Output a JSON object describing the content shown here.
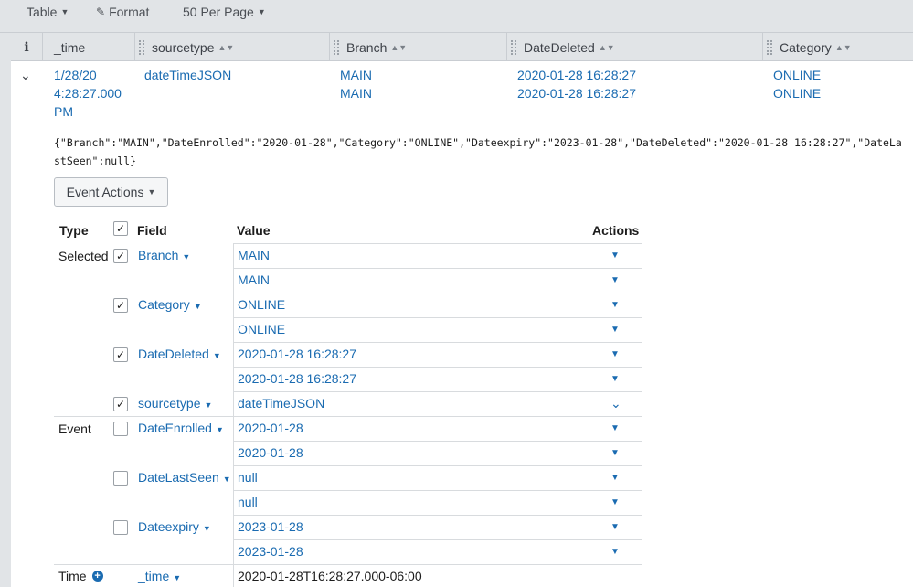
{
  "toolbar": {
    "table_label": "Table",
    "format_label": "Format",
    "per_page_label": "50 Per Page"
  },
  "columns": {
    "info": "i",
    "time": "_time",
    "sourcetype": "sourcetype",
    "branch": "Branch",
    "datedeleted": "DateDeleted",
    "category": "Category"
  },
  "event": {
    "time_line1": "1/28/20",
    "time_line2": "4:28:27.000",
    "time_line3": "PM",
    "sourcetype": "dateTimeJSON",
    "branch": [
      "MAIN",
      "MAIN"
    ],
    "datedeleted": [
      "2020-01-28 16:28:27",
      "2020-01-28 16:28:27"
    ],
    "category": [
      "ONLINE",
      "ONLINE"
    ],
    "raw_line1": "{\"Branch\":\"MAIN\",\"DateEnrolled\":\"2020-01-28\",\"Category\":\"ONLINE\",\"Dateexpiry\":\"2023-01-28\",\"DateDeleted\":\"2020-01-28 16:28:27\",\"DateLa",
    "raw_line2": "stSeen\":null}",
    "event_actions_label": "Event Actions"
  },
  "fields_table": {
    "headers": {
      "type": "Type",
      "field": "Field",
      "value": "Value",
      "actions": "Actions"
    },
    "groups": {
      "selected": "Selected",
      "event": "Event",
      "time": "Time"
    },
    "fields": {
      "branch": {
        "name": "Branch",
        "values": [
          "MAIN",
          "MAIN"
        ]
      },
      "category": {
        "name": "Category",
        "values": [
          "ONLINE",
          "ONLINE"
        ]
      },
      "datedeleted": {
        "name": "DateDeleted",
        "values": [
          "2020-01-28 16:28:27",
          "2020-01-28 16:28:27"
        ]
      },
      "sourcetype": {
        "name": "sourcetype",
        "values": [
          "dateTimeJSON"
        ]
      },
      "dateenrolled": {
        "name": "DateEnrolled",
        "values": [
          "2020-01-28",
          "2020-01-28"
        ]
      },
      "datelastseen": {
        "name": "DateLastSeen",
        "values": [
          "null",
          "null"
        ]
      },
      "dateexpiry": {
        "name": "Dateexpiry",
        "values": [
          "2023-01-28",
          "2023-01-28"
        ]
      },
      "time": {
        "name": "_time",
        "values": [
          "2020-01-28T16:28:27.000-06:00"
        ]
      }
    }
  },
  "colors": {
    "link": "#1a6bb1",
    "header_bg": "#e1e4e7"
  }
}
